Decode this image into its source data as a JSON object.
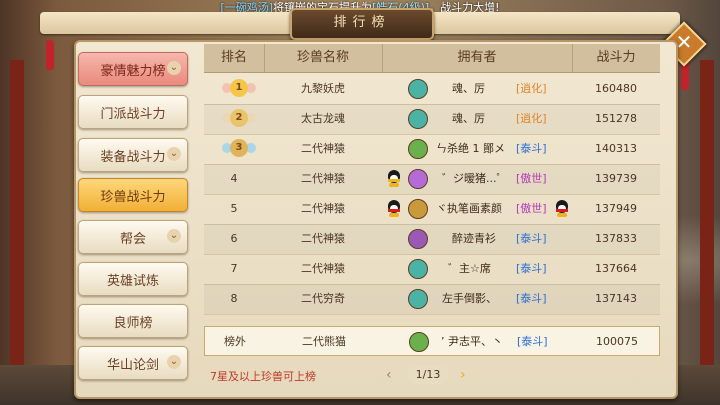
{
  "broadcast": {
    "player": "[一碗鸡汤]",
    "text_mid": "将镶嵌的宝石提升为",
    "gem": "[皓石(4级)]",
    "text_end": "，战斗力大增!"
  },
  "title": "排行榜",
  "close_label": "✕",
  "sidebar": {
    "items": [
      {
        "label": "豪情魅力榜",
        "state": "active-pink",
        "chevron": "⌄"
      },
      {
        "label": "门派战斗力",
        "state": "",
        "chevron": ""
      },
      {
        "label": "装备战斗力",
        "state": "",
        "chevron": "⌄"
      },
      {
        "label": "珍兽战斗力",
        "state": "active-gold",
        "chevron": ""
      },
      {
        "label": "帮会",
        "state": "",
        "chevron": "⌄"
      },
      {
        "label": "英雄试炼",
        "state": "",
        "chevron": ""
      },
      {
        "label": "良师榜",
        "state": "",
        "chevron": ""
      },
      {
        "label": "华山论剑",
        "state": "",
        "chevron": "⌄"
      }
    ]
  },
  "table": {
    "headers": {
      "rank": "排名",
      "beast": "珍兽名称",
      "owner": "拥有者",
      "power": "战斗力"
    },
    "rows": [
      {
        "rank": "1",
        "beast": "九黎妖虎",
        "owner": "魂、厉",
        "faction": "[逍化]",
        "faction_color": "#e0852a",
        "power": "160480"
      },
      {
        "rank": "2",
        "beast": "太古龙魂",
        "owner": "魂、厉",
        "faction": "[逍化]",
        "faction_color": "#e0852a",
        "power": "151278"
      },
      {
        "rank": "3",
        "beast": "二代神猿",
        "owner": "ㄣ杀绝 1 鄮メ",
        "faction": "[泰斗]",
        "faction_color": "#2d6fd6",
        "power": "140313"
      },
      {
        "rank": "4",
        "beast": "二代神猿",
        "owner": "゛ジ暧猪...゜",
        "faction": "[傲世]",
        "faction_color": "#b43ab8",
        "power": "139739"
      },
      {
        "rank": "5",
        "beast": "二代神猿",
        "owner": "ヾ执笔画素颜",
        "faction": "[傲世]",
        "faction_color": "#b43ab8",
        "power": "137949"
      },
      {
        "rank": "6",
        "beast": "二代神猿",
        "owner": "醉迹青衫",
        "faction": "[泰斗]",
        "faction_color": "#2d6fd6",
        "power": "137833"
      },
      {
        "rank": "7",
        "beast": "二代神猿",
        "owner": "゛主☆席",
        "faction": "[泰斗]",
        "faction_color": "#2d6fd6",
        "power": "137664"
      },
      {
        "rank": "8",
        "beast": "二代穷奇",
        "owner": "左手倒影、",
        "faction": "[泰斗]",
        "faction_color": "#2d6fd6",
        "power": "137143"
      }
    ],
    "mine": {
      "rank": "榜外",
      "beast": "二代熊猫",
      "owner": "ʼ 尹志平、丶",
      "faction": "[泰斗]",
      "faction_color": "#2d6fd6",
      "power": "100075"
    }
  },
  "footer": {
    "note": "7星及以上珍兽可上榜",
    "page": "1/13",
    "prev": "‹",
    "next": "›"
  }
}
